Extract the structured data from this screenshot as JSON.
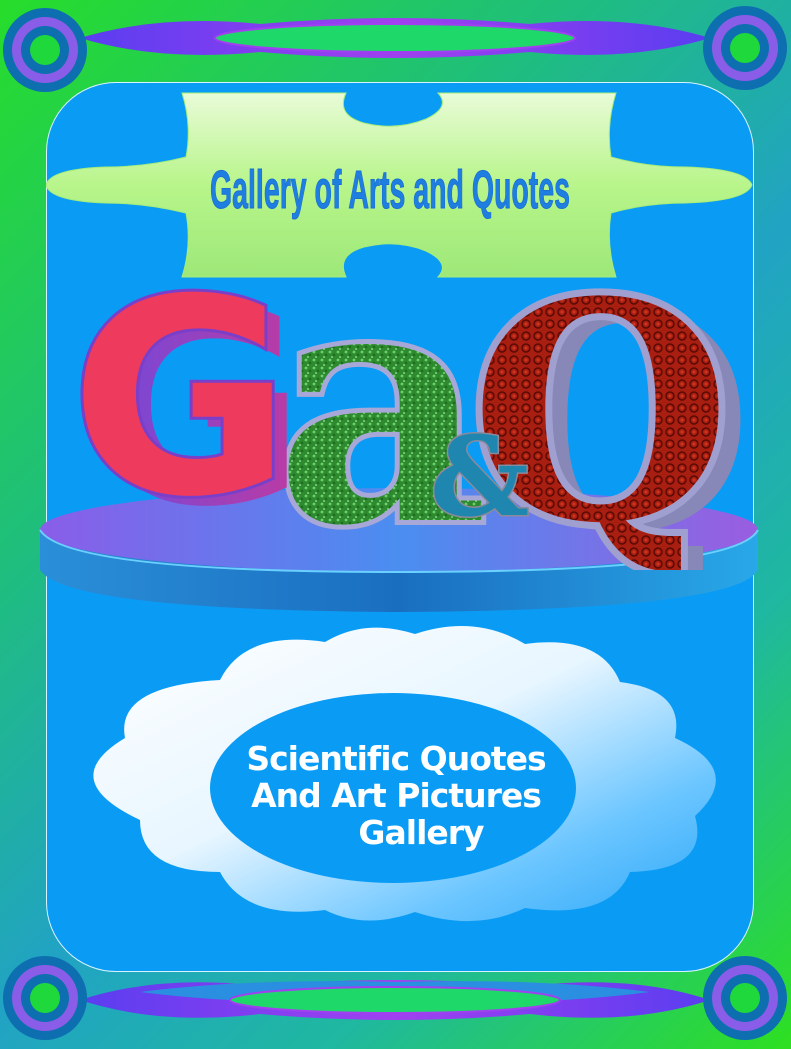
{
  "cover": {
    "title": "Gallery of Arts and Quotes",
    "logo_letters": {
      "g": "G",
      "a": "a",
      "ampersand": "&",
      "q": "Q"
    },
    "tagline": {
      "line1": "Scientific Quotes",
      "line2": "And Art Pictures",
      "line3": "Gallery"
    }
  },
  "colors": {
    "background_green": "#2ee020",
    "background_teal": "#1fa8b8",
    "frame_blue": "#0a9cf5",
    "puzzle_green": "#b8f58a",
    "title_blue": "#1f7fe0",
    "letter_g_red": "#ee3a5c",
    "letter_g_purple": "#7a3fc8",
    "letter_a_green": "#2e8a2e",
    "letter_q_red": "#a81e10",
    "pedestal_purple": "#8a5de8",
    "pedestal_blue": "#1a7fd0",
    "cloud_white": "#ffffff",
    "ring_blue": "#0d6fb0",
    "ring_purple": "#8a5de8",
    "ring_green": "#1fd83c"
  },
  "icons": [
    "corner-ring-icon",
    "puzzle-piece-icon",
    "cloud-icon",
    "pedestal-icon"
  ]
}
